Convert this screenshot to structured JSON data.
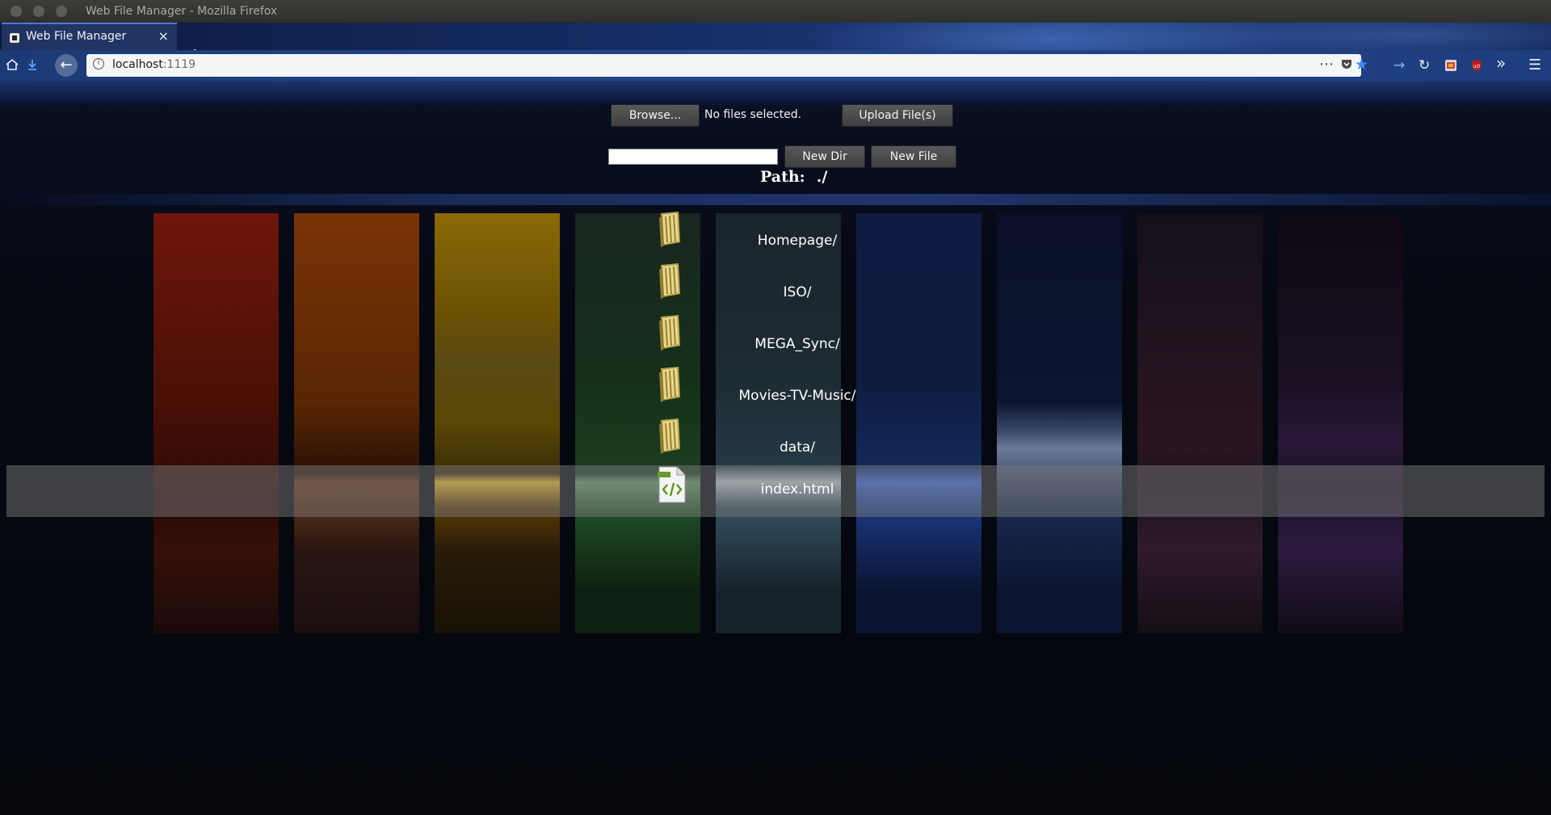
{
  "window": {
    "title": "Web File Manager - Mozilla Firefox"
  },
  "tab": {
    "label": "Web File Manager",
    "close": "×"
  },
  "new_tab": "+",
  "urlbar": {
    "host": "localhost",
    "port": ":1119"
  },
  "upload": {
    "browse_label": "Browse...",
    "status": "No files selected.",
    "upload_label": "Upload File(s)"
  },
  "create": {
    "input_value": "",
    "new_dir_label": "New Dir",
    "new_file_label": "New File"
  },
  "path": {
    "label": "Path:",
    "value": "./"
  },
  "entries": [
    {
      "name": "Homepage/",
      "type": "folder-icon"
    },
    {
      "name": "ISO/",
      "type": "folder-icon"
    },
    {
      "name": "MEGA_Sync/",
      "type": "folder-icon"
    },
    {
      "name": "Movies-TV-Music/",
      "type": "folder-icon"
    },
    {
      "name": "data/",
      "type": "folder-icon"
    },
    {
      "name": "index.html",
      "type": "html-file-icon",
      "highlighted": true
    }
  ],
  "colors": {
    "highlight_row": "#7a7a7a",
    "button_bg": "#4c4c4c",
    "panels": [
      "#7a1a0e",
      "#8a3a06",
      "#9a7a08",
      "#1d4a1e",
      "#2b3c44",
      "#10204a",
      "#0c1430",
      "#2a1a2a",
      "#241430"
    ]
  }
}
